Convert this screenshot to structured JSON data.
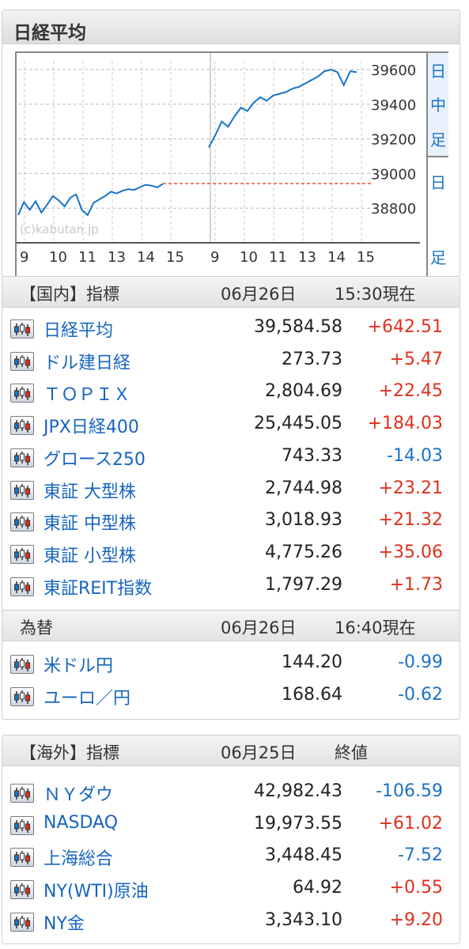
{
  "nikkei_panel": {
    "title": "日経平均",
    "side_tabs": [
      {
        "lines": [
          "日",
          "中",
          "足"
        ]
      },
      {
        "lines": [
          "日",
          "",
          "足"
        ]
      }
    ],
    "watermark": "(c)kabutan.jp"
  },
  "chart_data": {
    "type": "line",
    "y_ticks": [
      39600,
      39400,
      39200,
      39000,
      38800
    ],
    "y_tick_labels": [
      "39600",
      "39400",
      "39200",
      "39000",
      "38800"
    ],
    "ylim": [
      38600,
      39650
    ],
    "x_tick_labels": [
      "9",
      "10",
      "11",
      "13",
      "14",
      "15",
      "9",
      "10",
      "11",
      "13",
      "14",
      "15"
    ],
    "reference_line": {
      "value": 38942,
      "note": "previous close"
    },
    "series": [
      {
        "values": [
          38760,
          38835,
          38790,
          38840,
          38775,
          38820,
          38870,
          38845,
          38810,
          38860,
          38880,
          38790,
          38760,
          38830,
          38850,
          38870,
          38895,
          38885,
          38900,
          38910,
          38905,
          38920,
          38935,
          38930,
          38920,
          38940
        ]
      },
      {
        "values": [
          39150,
          39220,
          39300,
          39270,
          39330,
          39380,
          39360,
          39410,
          39440,
          39420,
          39450,
          39460,
          39470,
          39490,
          39500,
          39520,
          39540,
          39560,
          39590,
          39600,
          39585,
          39510,
          39590,
          39585
        ]
      }
    ]
  },
  "domestic": {
    "header": {
      "label": "【国内】指標",
      "date": "06月26日",
      "time": "15:30現在"
    },
    "rows": [
      {
        "name": "日経平均",
        "value": "39,584.58",
        "change": "+642.51",
        "dir": "up"
      },
      {
        "name": "ドル建日経",
        "value": "273.73",
        "change": "+5.47",
        "dir": "up"
      },
      {
        "name": "ＴＯＰＩＸ",
        "value": "2,804.69",
        "change": "+22.45",
        "dir": "up"
      },
      {
        "name": "JPX日経400",
        "value": "25,445.05",
        "change": "+184.03",
        "dir": "up"
      },
      {
        "name": "グロース250",
        "value": "743.33",
        "change": "-14.03",
        "dir": "down"
      },
      {
        "name": "東証 大型株",
        "value": "2,744.98",
        "change": "+23.21",
        "dir": "up"
      },
      {
        "name": "東証 中型株",
        "value": "3,018.93",
        "change": "+21.32",
        "dir": "up"
      },
      {
        "name": "東証 小型株",
        "value": "4,775.26",
        "change": "+35.06",
        "dir": "up"
      },
      {
        "name": "東証REIT指数",
        "value": "1,797.29",
        "change": "+1.73",
        "dir": "up"
      }
    ]
  },
  "fx": {
    "header": {
      "label": "為替",
      "date": "06月26日",
      "time_red": "16:40",
      "time_suffix": "現在"
    },
    "rows": [
      {
        "name": "米ドル円",
        "value": "144.20",
        "change": "-0.99",
        "dir": "down"
      },
      {
        "name": "ユーロ／円",
        "value": "168.64",
        "change": "-0.62",
        "dir": "down"
      }
    ]
  },
  "overseas": {
    "header": {
      "label": "【海外】指標",
      "date": "06月25日",
      "time": "終値"
    },
    "rows": [
      {
        "name": "ＮＹダウ",
        "value": "42,982.43",
        "change": "-106.59",
        "dir": "down"
      },
      {
        "name": "NASDAQ",
        "value": "19,973.55",
        "change": "+61.02",
        "dir": "up"
      },
      {
        "name": "上海総合",
        "value": "3,448.45",
        "change": "-7.52",
        "dir": "down"
      },
      {
        "name": "NY(WTI)原油",
        "value": "64.92",
        "change": "+0.55",
        "dir": "up"
      },
      {
        "name": "NY金",
        "value": "3,343.10",
        "change": "+9.20",
        "dir": "up"
      }
    ]
  },
  "colors": {
    "line": "#1a73c8",
    "reference": "#e05a2a",
    "up": "#e0301e",
    "down": "#1a73c8",
    "link": "#1665c0"
  }
}
